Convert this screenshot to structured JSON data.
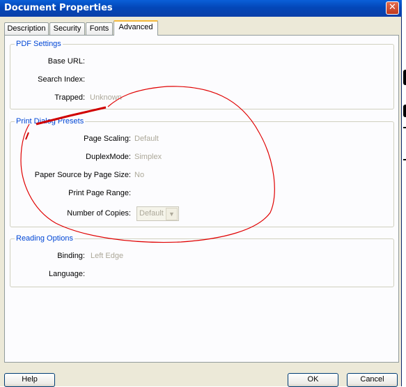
{
  "window": {
    "title": "Document Properties",
    "close_glyph": "✕"
  },
  "tabs": [
    {
      "label": "Description"
    },
    {
      "label": "Security"
    },
    {
      "label": "Fonts"
    },
    {
      "label": "Advanced"
    }
  ],
  "pdf_settings": {
    "legend": "PDF Settings",
    "base_url_label": "Base URL:",
    "search_index_label": "Search Index:",
    "trapped_label": "Trapped:",
    "trapped_value": "Unknown"
  },
  "print_presets": {
    "legend": "Print Dialog Presets",
    "page_scaling_label": "Page Scaling:",
    "page_scaling_value": "Default",
    "duplex_label": "DuplexMode:",
    "duplex_value": "Simplex",
    "paper_source_label": "Paper Source by Page Size:",
    "paper_source_value": "No",
    "print_range_label": "Print Page Range:",
    "copies_label": "Number of Copies:",
    "copies_value": "Default"
  },
  "reading_options": {
    "legend": "Reading Options",
    "binding_label": "Binding:",
    "binding_value": "Left Edge",
    "language_label": "Language:"
  },
  "buttons": {
    "help": "Help",
    "ok": "OK",
    "cancel": "Cancel"
  },
  "colors": {
    "title_bar": "#0a5fd8",
    "dialog_bg": "#ece9d8",
    "legend": "#0046d5",
    "disabled_text": "#aca899",
    "annotation": "#e00000"
  }
}
